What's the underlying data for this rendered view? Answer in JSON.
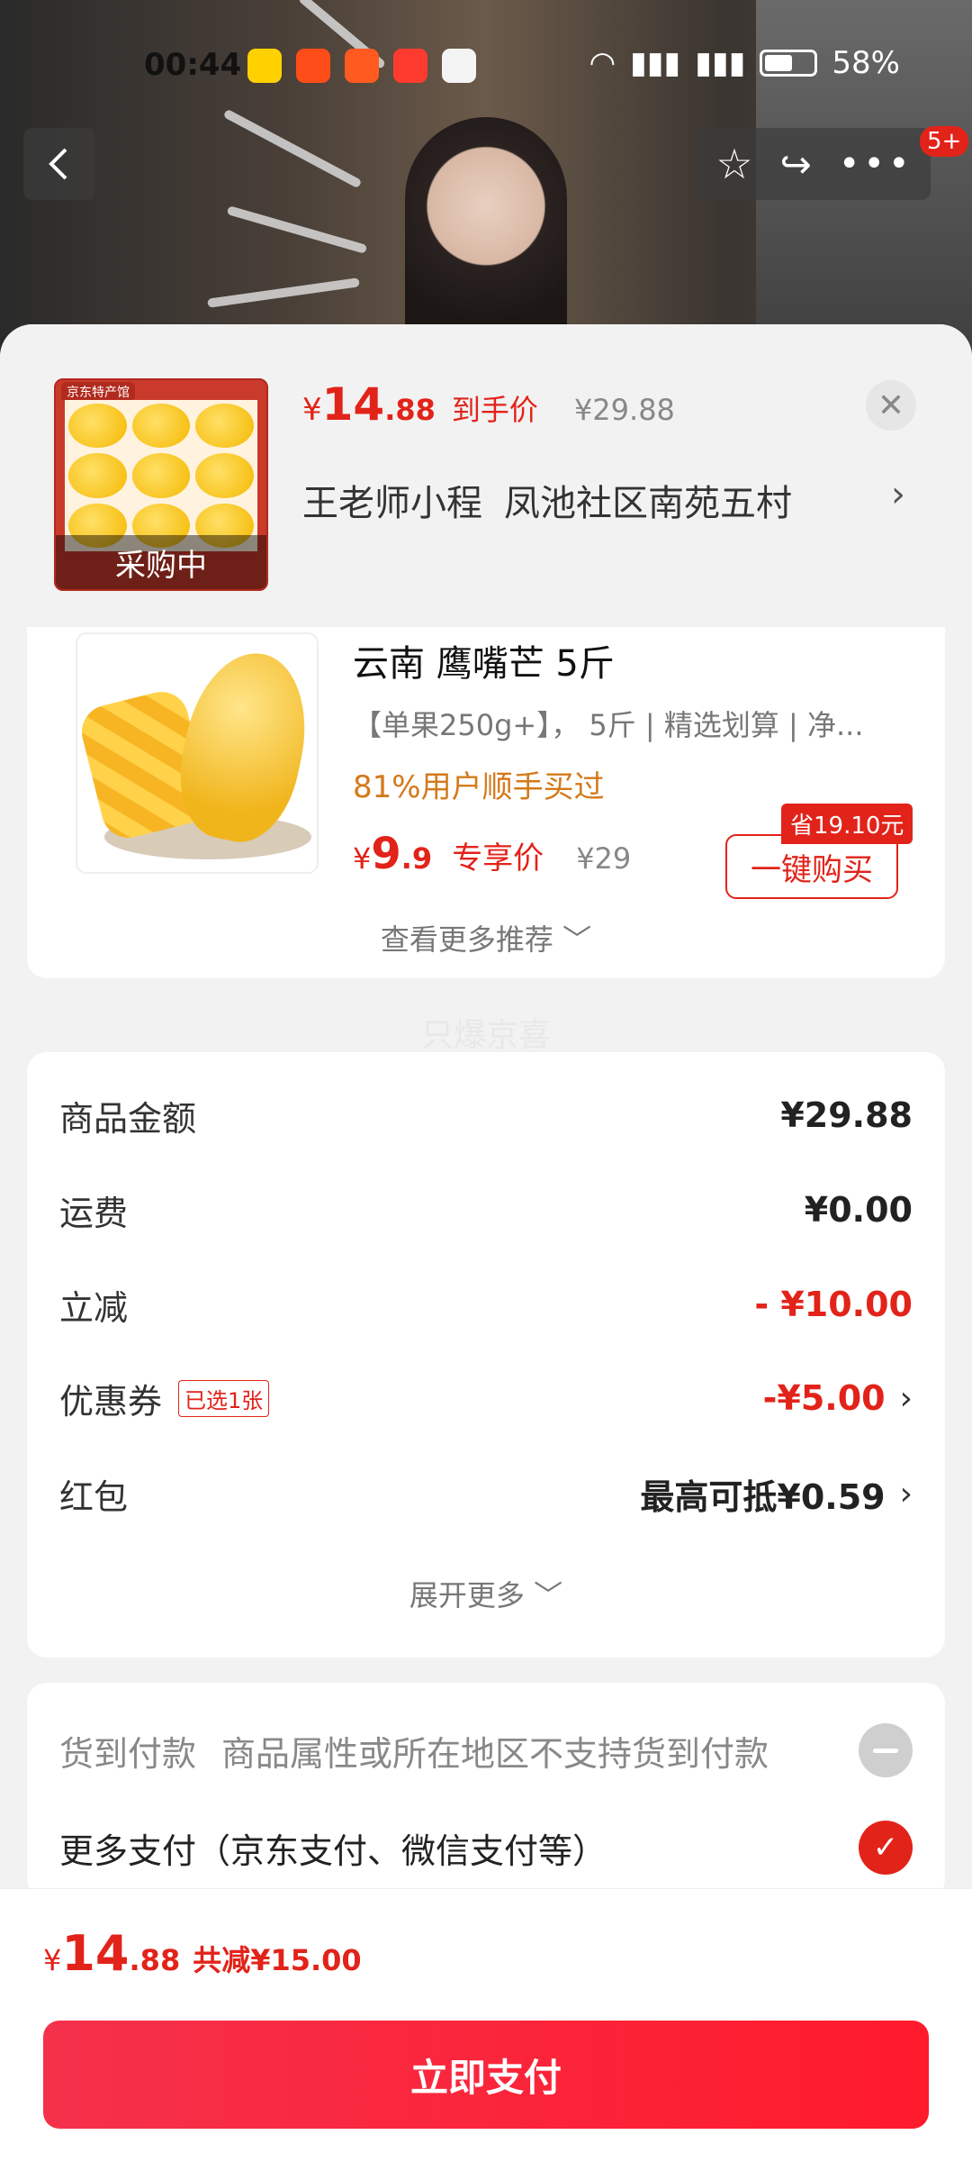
{
  "status_bar": {
    "time": "00:44",
    "app_icons": [
      "美团",
      "淘宝",
      "快手",
      "慢",
      "realme"
    ],
    "battery": "58%"
  },
  "top_nav": {
    "back_icon": "chevron-left-icon",
    "notification_badge": "5+"
  },
  "order_header": {
    "product_thumb_overlay": "采购中",
    "price_symbol": "¥",
    "price_int": "14",
    "price_dec": ".88",
    "price_tag": "到手价",
    "original_price": "¥29.88",
    "recipient": "王老师小程",
    "address": "凤池社区南苑五村"
  },
  "recommendation": {
    "name": "云南 鹰嘴芒 5斤",
    "desc": "【单果250g+】， 5斤 | 精选划算 | 净...",
    "bought": "81%用户顺手买过",
    "price_symbol": "¥",
    "price_int": "9",
    "price_dec": ".9",
    "price_tag": "专享价",
    "original_price": "¥29",
    "save_badge": "省19.10元",
    "buy_label": "一键购买",
    "more_label": "查看更多推荐 ﹀"
  },
  "watermark": "只爆京喜",
  "amounts": {
    "goods_label": "商品金额",
    "goods_value": "¥29.88",
    "shipping_label": "运费",
    "shipping_value": "¥0.00",
    "discount_label": "立减",
    "discount_value": "- ¥10.00",
    "coupon_label": "优惠券",
    "coupon_tag": "已选1张",
    "coupon_value": "-¥5.00",
    "redpacket_label": "红包",
    "redpacket_value": "最高可抵¥0.59",
    "expand_label": "展开更多 ﹀"
  },
  "payment": {
    "cod_label": "货到付款",
    "cod_desc": "商品属性或所在地区不支持货到付款",
    "more_label": "更多支付（京东支付、微信支付等）"
  },
  "footer": {
    "total_symbol": "¥",
    "total_int": "14",
    "total_dec": ".88",
    "total_save": "共减¥15.00",
    "pay_button": "立即支付"
  },
  "colors": {
    "accent": "#e2231a",
    "bought_orange": "#d4791a"
  }
}
